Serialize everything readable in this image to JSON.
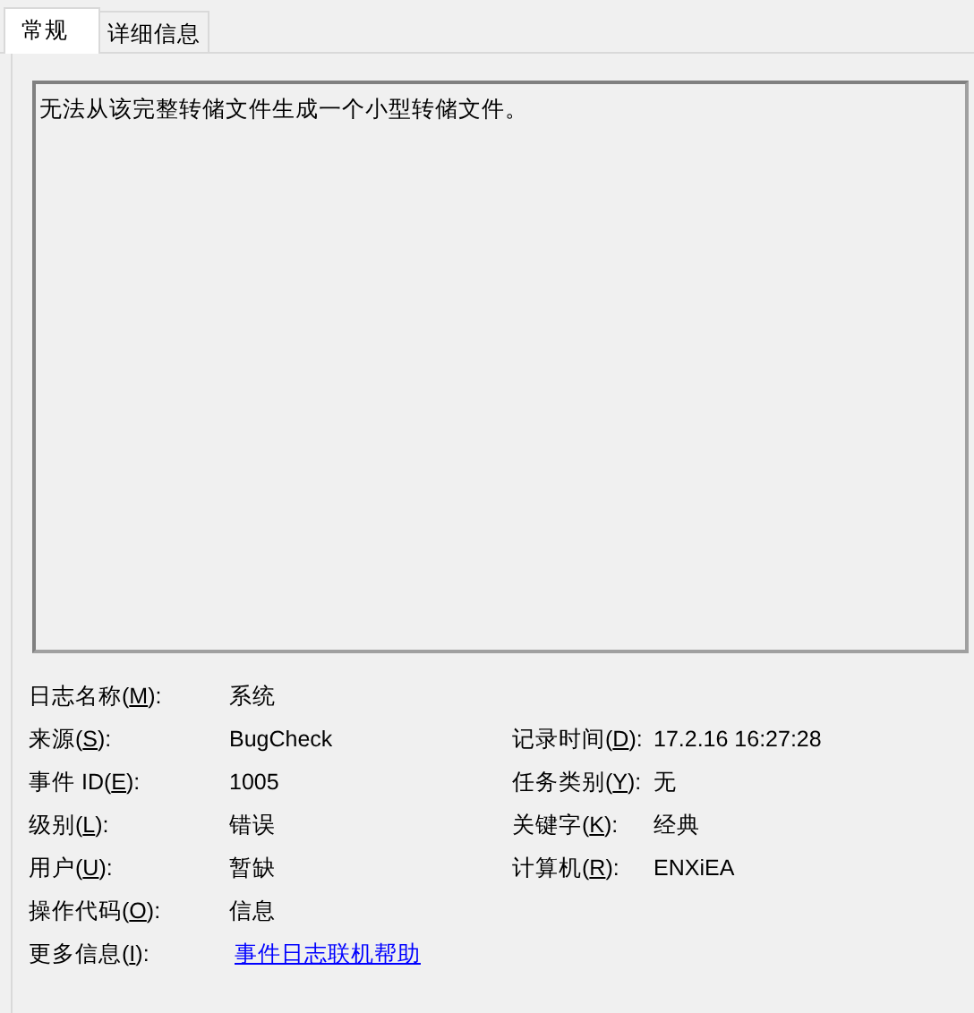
{
  "tabs": [
    {
      "label": "常规",
      "selected": true
    },
    {
      "label": "详细信息",
      "selected": false
    }
  ],
  "description": "无法从该完整转储文件生成一个小型转储文件。",
  "rows": [
    {
      "left": {
        "label": [
          "日志名称(",
          "M",
          "):"
        ],
        "value": "系统",
        "kind": "text"
      }
    },
    {
      "left": {
        "label": [
          "来源(",
          "S",
          "):"
        ],
        "value": "BugCheck",
        "kind": "text"
      },
      "right": {
        "label": [
          "记录时间(",
          "D",
          "):"
        ],
        "value": "17.2.16 16:27:28",
        "kind": "text"
      }
    },
    {
      "left": {
        "label": [
          "事件 ID(",
          "E",
          "):"
        ],
        "value": "1005",
        "kind": "text"
      },
      "right": {
        "label": [
          "任务类别(",
          "Y",
          "):"
        ],
        "value": "无",
        "kind": "text"
      }
    },
    {
      "left": {
        "label": [
          "级别(",
          "L",
          "):"
        ],
        "value": "错误",
        "kind": "text"
      },
      "right": {
        "label": [
          "关键字(",
          "K",
          "):"
        ],
        "value": "经典",
        "kind": "text"
      }
    },
    {
      "left": {
        "label": [
          "用户(",
          "U",
          "):"
        ],
        "value": "暂缺",
        "kind": "text"
      },
      "right": {
        "label": [
          "计算机(",
          "R",
          "):"
        ],
        "value": "ENXiEA",
        "kind": "text"
      }
    },
    {
      "left": {
        "label": [
          "操作代码(",
          "O",
          "):"
        ],
        "value": "信息",
        "kind": "text"
      }
    },
    {
      "left": {
        "label": [
          "更多信息(",
          "I",
          "):"
        ],
        "value": "事件日志联机帮助",
        "kind": "link"
      }
    }
  ]
}
